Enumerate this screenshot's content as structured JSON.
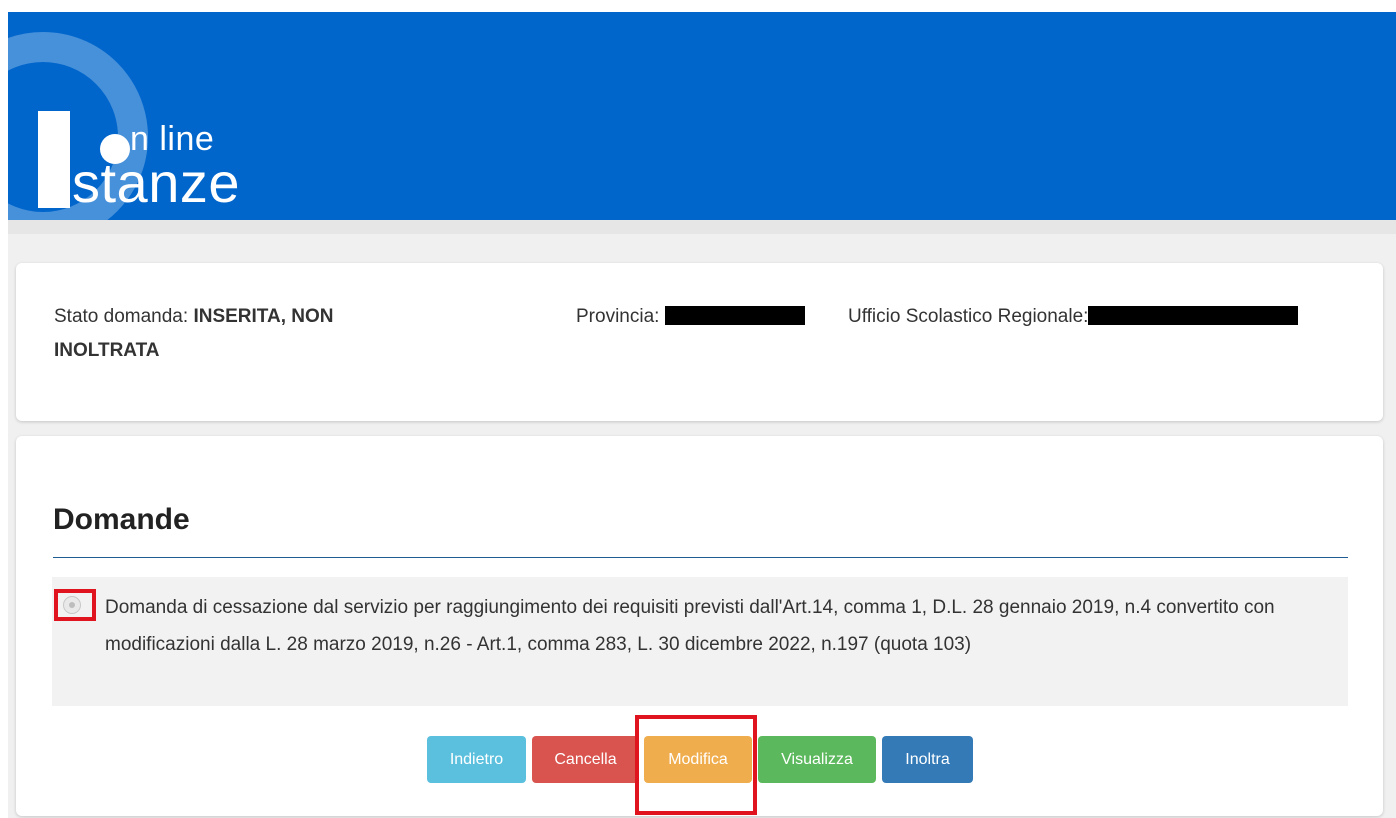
{
  "header": {
    "logo_line1": "n line",
    "logo_line2": "stanze",
    "background_color": "#0066cc"
  },
  "status": {
    "stato_label": "Stato domanda:",
    "stato_value": "INSERITA, NON INOLTRATA",
    "provincia_label": "Provincia:",
    "usr_label": "Ufficio Scolastico Regionale:"
  },
  "domande": {
    "title": "Domande",
    "items": [
      {
        "text": "Domanda di cessazione dal servizio per raggiungimento dei requisiti previsti dall'Art.14, comma 1, D.L. 28 gennaio 2019, n.4 convertito con modificazioni dalla L. 28 marzo 2019, n.26 - Art.1, comma 283, L. 30 dicembre 2022, n.197 (quota 103)"
      }
    ]
  },
  "buttons": {
    "indietro": "Indietro",
    "cancella": "Cancella",
    "modifica": "Modifica",
    "visualizza": "Visualizza",
    "inoltra": "Inoltra"
  },
  "colors": {
    "indietro": "#5bc0de",
    "cancella": "#d9534f",
    "modifica": "#f0ad4e",
    "visualizza": "#5cb85c",
    "inoltra": "#337ab7",
    "highlight": "#e0141e"
  }
}
